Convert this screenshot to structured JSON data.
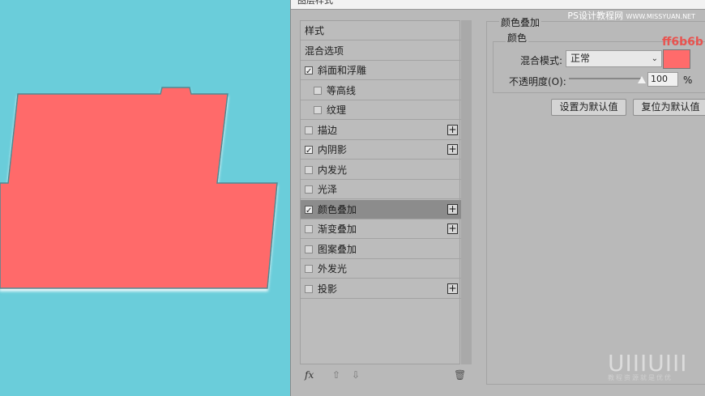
{
  "dialog": {
    "title": "图层样式",
    "site_watermark": "PS设计教程网",
    "site_url": "WWW.MISSYUAN.NET"
  },
  "styles_list": {
    "items": [
      {
        "label": "样式",
        "checkbox": false,
        "checked": false,
        "plus": false,
        "indent": false,
        "selected": false
      },
      {
        "label": "混合选项",
        "checkbox": false,
        "checked": false,
        "plus": false,
        "indent": false,
        "selected": false
      },
      {
        "label": "斜面和浮雕",
        "checkbox": true,
        "checked": true,
        "plus": false,
        "indent": false,
        "selected": false
      },
      {
        "label": "等高线",
        "checkbox": true,
        "checked": false,
        "plus": false,
        "indent": true,
        "selected": false
      },
      {
        "label": "纹理",
        "checkbox": true,
        "checked": false,
        "plus": false,
        "indent": true,
        "selected": false
      },
      {
        "label": "描边",
        "checkbox": true,
        "checked": false,
        "plus": true,
        "indent": false,
        "selected": false
      },
      {
        "label": "内阴影",
        "checkbox": true,
        "checked": true,
        "plus": true,
        "indent": false,
        "selected": false
      },
      {
        "label": "内发光",
        "checkbox": true,
        "checked": false,
        "plus": false,
        "indent": false,
        "selected": false
      },
      {
        "label": "光泽",
        "checkbox": true,
        "checked": false,
        "plus": false,
        "indent": false,
        "selected": false
      },
      {
        "label": "颜色叠加",
        "checkbox": true,
        "checked": true,
        "plus": true,
        "indent": false,
        "selected": true
      },
      {
        "label": "渐变叠加",
        "checkbox": true,
        "checked": false,
        "plus": true,
        "indent": false,
        "selected": false
      },
      {
        "label": "图案叠加",
        "checkbox": true,
        "checked": false,
        "plus": false,
        "indent": false,
        "selected": false
      },
      {
        "label": "外发光",
        "checkbox": true,
        "checked": false,
        "plus": false,
        "indent": false,
        "selected": false
      },
      {
        "label": "投影",
        "checkbox": true,
        "checked": false,
        "plus": true,
        "indent": false,
        "selected": false
      }
    ],
    "footer": {
      "fx": "fx",
      "up_icon": "arrow-up-icon",
      "down_icon": "arrow-down-icon",
      "trash_icon": "trash-icon"
    }
  },
  "color_overlay": {
    "section_title": "颜色叠加",
    "group_title": "颜色",
    "blend_mode_label": "混合模式:",
    "blend_mode_value": "正常",
    "opacity_label": "不透明度(O):",
    "opacity_value": "100",
    "opacity_unit": "%",
    "opacity_level": 1.0,
    "color_hex_label": "ff6b6b",
    "color": "#ff6b6b",
    "set_default_button": "设置为默认值",
    "reset_default_button": "复位为默认值"
  },
  "canvas": {
    "background": "#6acdda",
    "shape_fill": "#ff6b6b"
  },
  "watermark": {
    "logo": "UIIIUIII",
    "sub": "教程资源就是优优"
  }
}
